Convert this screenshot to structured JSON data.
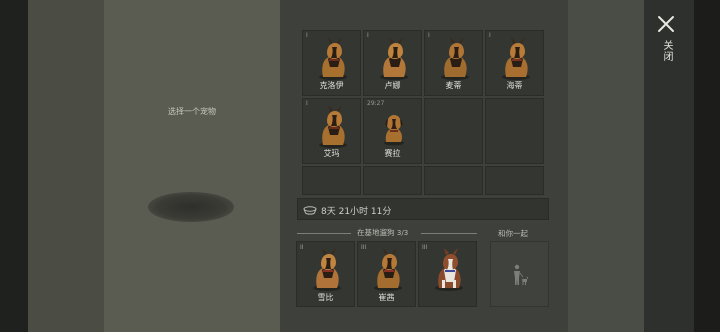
{
  "left": {
    "hint": "选择一个宠物"
  },
  "close": {
    "label": "关闭",
    "icon": "close-icon"
  },
  "pets": [
    {
      "level": "I",
      "name": "克洛伊",
      "breed": "shepherd"
    },
    {
      "level": "I",
      "name": "卢娜",
      "breed": "shepherd"
    },
    {
      "level": "I",
      "name": "麦蒂",
      "breed": "shepherd"
    },
    {
      "level": "I",
      "name": "海蒂",
      "breed": "shepherd"
    },
    {
      "level": "I",
      "name": "艾玛",
      "breed": "shepherd"
    },
    {
      "level": "29:27",
      "name": "赛拉",
      "breed": "puppy"
    }
  ],
  "timer": {
    "text": "8天 21小时 11分",
    "icon": "pet-bowl-icon"
  },
  "base_section": {
    "label": "在基地遛狗",
    "count": "3/3"
  },
  "with_section": {
    "label": "和你一起",
    "icon": "person-with-dog-icon"
  },
  "base_pets": [
    {
      "level": "II",
      "name": "雪比",
      "breed": "shepherd"
    },
    {
      "level": "III",
      "name": "崔茜",
      "breed": "shepherd"
    },
    {
      "level": "III",
      "name": "",
      "breed": "husky"
    }
  ],
  "colors": {
    "panel": "#3e403b",
    "cell": "#343632",
    "text": "#e2e2dc"
  }
}
